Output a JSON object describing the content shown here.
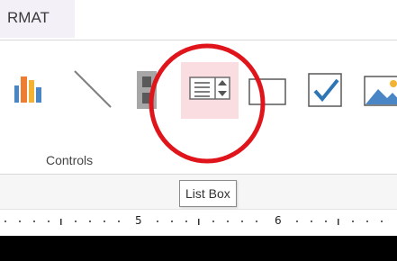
{
  "tab": {
    "label": "RMAT"
  },
  "ribbon": {
    "group_label": "Controls",
    "controls": [
      {
        "name": "chart",
        "icon": "bar-chart-icon"
      },
      {
        "name": "line",
        "icon": "line-icon"
      },
      {
        "name": "toggle-button",
        "icon": "toggle-button-icon"
      },
      {
        "name": "list-box",
        "icon": "list-box-icon"
      },
      {
        "name": "rectangle",
        "icon": "rectangle-icon"
      },
      {
        "name": "check-box",
        "icon": "check-box-icon"
      },
      {
        "name": "image",
        "icon": "image-icon"
      }
    ],
    "highlight_color": "#f9dde0",
    "annotation_color": "#e0151b"
  },
  "tooltip": {
    "text": "List Box"
  },
  "ruler": {
    "labels": [
      "5",
      "6"
    ]
  }
}
